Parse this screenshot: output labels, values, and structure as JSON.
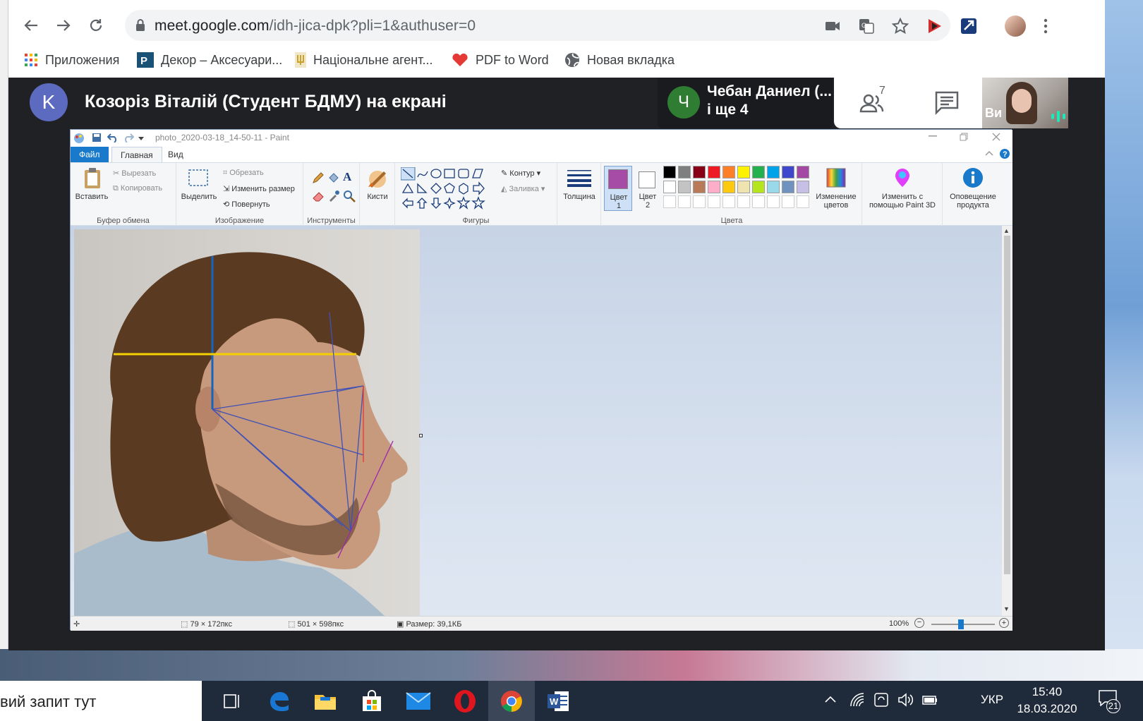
{
  "browser": {
    "url_host": "meet.google.com",
    "url_path": "/idh-jica-dpk?pli=1&authuser=0",
    "bookmarks": [
      {
        "label": "Приложения",
        "icon": "apps-grid-icon"
      },
      {
        "label": "Декор – Аксесуари...",
        "icon": "decor-site-icon"
      },
      {
        "label": "Національне агент...",
        "icon": "trident-icon"
      },
      {
        "label": "PDF to Word",
        "icon": "heart-pdf-icon"
      },
      {
        "label": "Новая вкладка",
        "icon": "globe-icon"
      }
    ]
  },
  "meet": {
    "presenter_initial": "K",
    "presenting_text": "Козоріз Віталій (Студент БДМУ) на екрані",
    "participant_initial": "Ч",
    "participant_name": "Чебан Даниел (...",
    "participant_more": "і ще 4",
    "participants_count": "7",
    "self_label": "Ви",
    "colors": {
      "presenter_avatar": "#5c6bc0",
      "participant_avatar": "#2e7d32"
    }
  },
  "paint": {
    "title": "photo_2020-03-18_14-50-11 - Paint",
    "tabs": {
      "file": "Файл",
      "home": "Главная",
      "view": "Вид"
    },
    "clipboard": {
      "paste": "Вставить",
      "cut": "Вырезать",
      "copy": "Копировать",
      "label": "Буфер обмена"
    },
    "image": {
      "select": "Выделить",
      "crop": "Обрезать",
      "resize": "Изменить размер",
      "rotate": "Повернуть",
      "label": "Изображение"
    },
    "tools": {
      "label": "Инструменты"
    },
    "brushes": {
      "label": "Кисти"
    },
    "shapes": {
      "outline": "Контур",
      "fill": "Заливка",
      "label": "Фигуры"
    },
    "thickness": "Толщина",
    "color1": {
      "line1": "Цвет",
      "line2": "1",
      "value": "#a64ca6"
    },
    "color2": {
      "line1": "Цвет",
      "line2": "2",
      "value": "#ffffff"
    },
    "colors_label": "Цвета",
    "edit_colors": {
      "line1": "Изменение",
      "line2": "цветов"
    },
    "paint3d": {
      "line1": "Изменить с",
      "line2": "помощью Paint 3D"
    },
    "notice": {
      "line1": "Оповещение",
      "line2": "продукта"
    },
    "palette_row1": [
      "#000000",
      "#7f7f7f",
      "#880015",
      "#ed1c24",
      "#ff7f27",
      "#fff200",
      "#22b14c",
      "#00a2e8",
      "#3f48cc",
      "#a349a4"
    ],
    "palette_row2": [
      "#ffffff",
      "#c3c3c3",
      "#b97a57",
      "#ffaec9",
      "#ffc90e",
      "#efe4b0",
      "#b5e61d",
      "#99d9ea",
      "#7092be",
      "#c8bfe7"
    ],
    "status": {
      "selection": "79 × 172пкс",
      "image_size": "501 × 598пкс",
      "file_size": "Размер: 39,1КБ",
      "zoom": "100%"
    }
  },
  "taskbar": {
    "search_text": "вий запит тут",
    "language": "УКР",
    "time": "15:40",
    "date": "18.03.2020",
    "notifications": "21"
  }
}
